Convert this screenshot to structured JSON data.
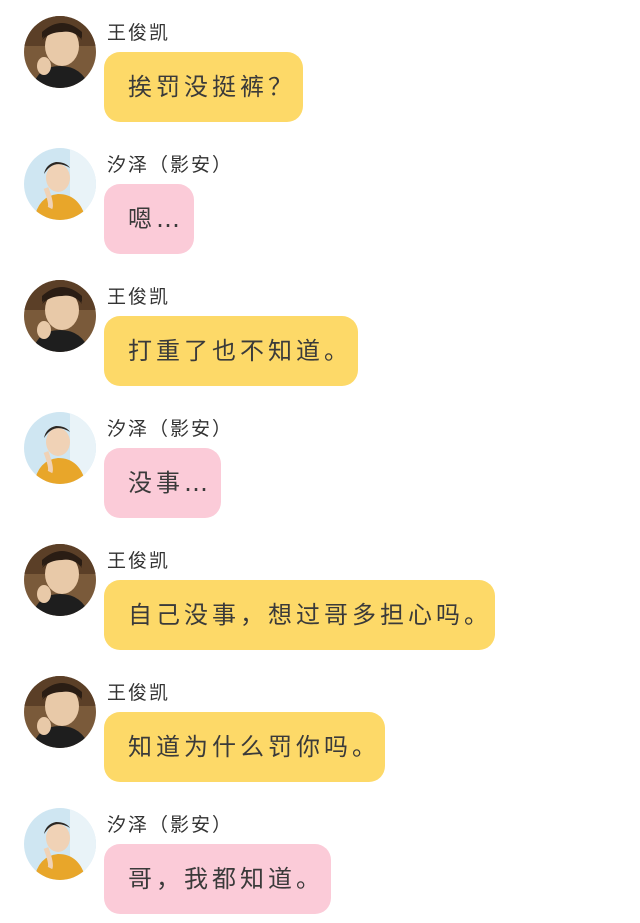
{
  "colors": {
    "bubble_a": "#fdd968",
    "bubble_b": "#fbcbd8",
    "text": "#3a3a3a"
  },
  "messages": [
    {
      "sender": "王俊凯",
      "text": "挨罚没挺裤？",
      "style": "yellow",
      "avatar": "avatar-wangjunkai"
    },
    {
      "sender": "汐泽（影安）",
      "text": "嗯…",
      "style": "pink",
      "avatar": "avatar-xize"
    },
    {
      "sender": "王俊凯",
      "text": "打重了也不知道。",
      "style": "yellow",
      "avatar": "avatar-wangjunkai"
    },
    {
      "sender": "汐泽（影安）",
      "text": "没事…",
      "style": "pink",
      "avatar": "avatar-xize"
    },
    {
      "sender": "王俊凯",
      "text": "自己没事，想过哥多担心吗。",
      "style": "yellow",
      "avatar": "avatar-wangjunkai"
    },
    {
      "sender": "王俊凯",
      "text": "知道为什么罚你吗。",
      "style": "yellow",
      "avatar": "avatar-wangjunkai"
    },
    {
      "sender": "汐泽（影安）",
      "text": "哥，我都知道。",
      "style": "pink",
      "avatar": "avatar-xize"
    }
  ]
}
